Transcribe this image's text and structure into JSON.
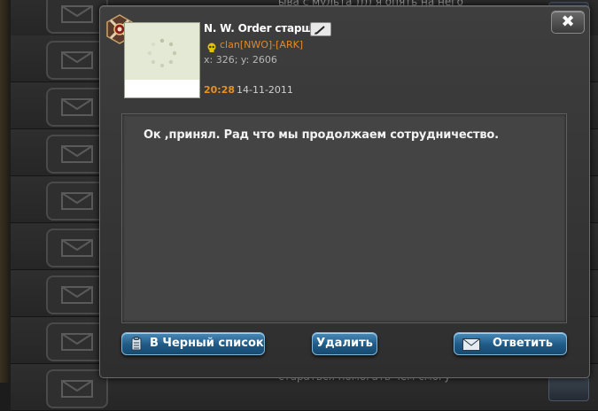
{
  "background": {
    "top_text": "ыва с мульта )))) я опять на него",
    "bottom_text": "стараться помогать чем смогу",
    "rows": 8
  },
  "message": {
    "sender": "N. W. Order старший",
    "clan": "clan[NWO]-[ARK]",
    "coords": "x: 326; y: 2606",
    "time": "20:28",
    "date": "14-11-2011",
    "body": "Ок ,принял. Рад что мы продолжаем сотрудничество."
  },
  "buttons": {
    "close": "✖",
    "blacklist": "В Черный список",
    "delete": "Удалить",
    "reply": "Ответить"
  },
  "colors": {
    "accent_orange": "#e8901e",
    "button_blue": "#1f5a86"
  },
  "icons": {
    "rank": "rank-emblem-icon",
    "edit": "pencil-icon",
    "clan": "skull-icon",
    "blacklist": "clipboard-icon",
    "reply": "envelope-icon",
    "avatar": "loading-spinner-icon"
  }
}
